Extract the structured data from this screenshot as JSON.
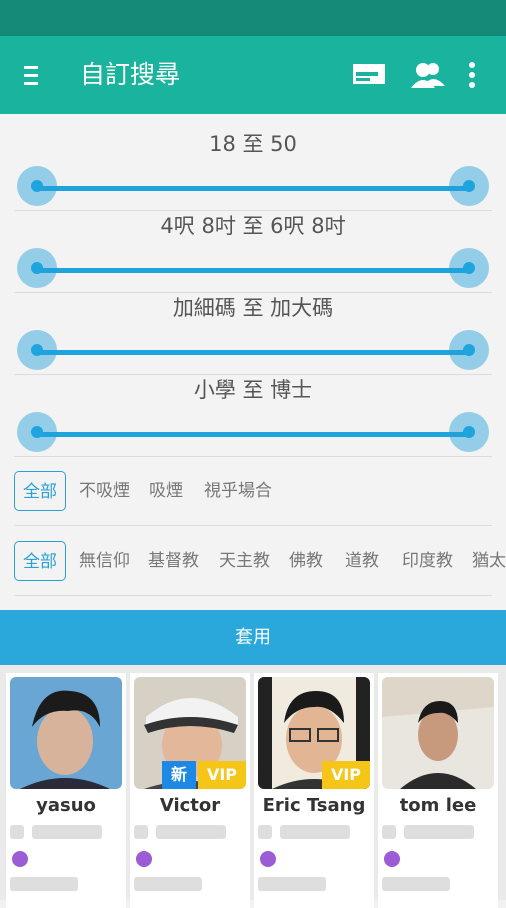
{
  "app": {
    "title": "自訂搜尋"
  },
  "ranges": [
    {
      "label": "18 至 50",
      "low": 0,
      "high": 1
    },
    {
      "label": "4呎 8吋 至 6呎 8吋",
      "low": 0,
      "high": 1
    },
    {
      "label": "加細碼 至 加大碼",
      "low": 0,
      "high": 1
    },
    {
      "label": "小學 至 博士",
      "low": 0,
      "high": 1
    }
  ],
  "smoking_filters": [
    "全部",
    "不吸煙",
    "吸煙",
    "視乎場合"
  ],
  "religion_filters": [
    "全部",
    "無信仰",
    "基督教",
    "天主教",
    "佛教",
    "道教",
    "印度教",
    "猶太教"
  ],
  "apply_button": "套用",
  "profiles": [
    {
      "name": "yasuo",
      "badges": []
    },
    {
      "name": "Victor",
      "badges": [
        "新",
        "VIP"
      ]
    },
    {
      "name": "Eric Tsang",
      "badges": [
        "VIP"
      ]
    },
    {
      "name": "tom lee",
      "badges": []
    }
  ],
  "colors": {
    "primary": "#1ab39e",
    "status_bar": "#168a78",
    "accent": "#2aa8dc",
    "new_badge": "#1e88e5",
    "vip_badge": "#f5c518"
  }
}
